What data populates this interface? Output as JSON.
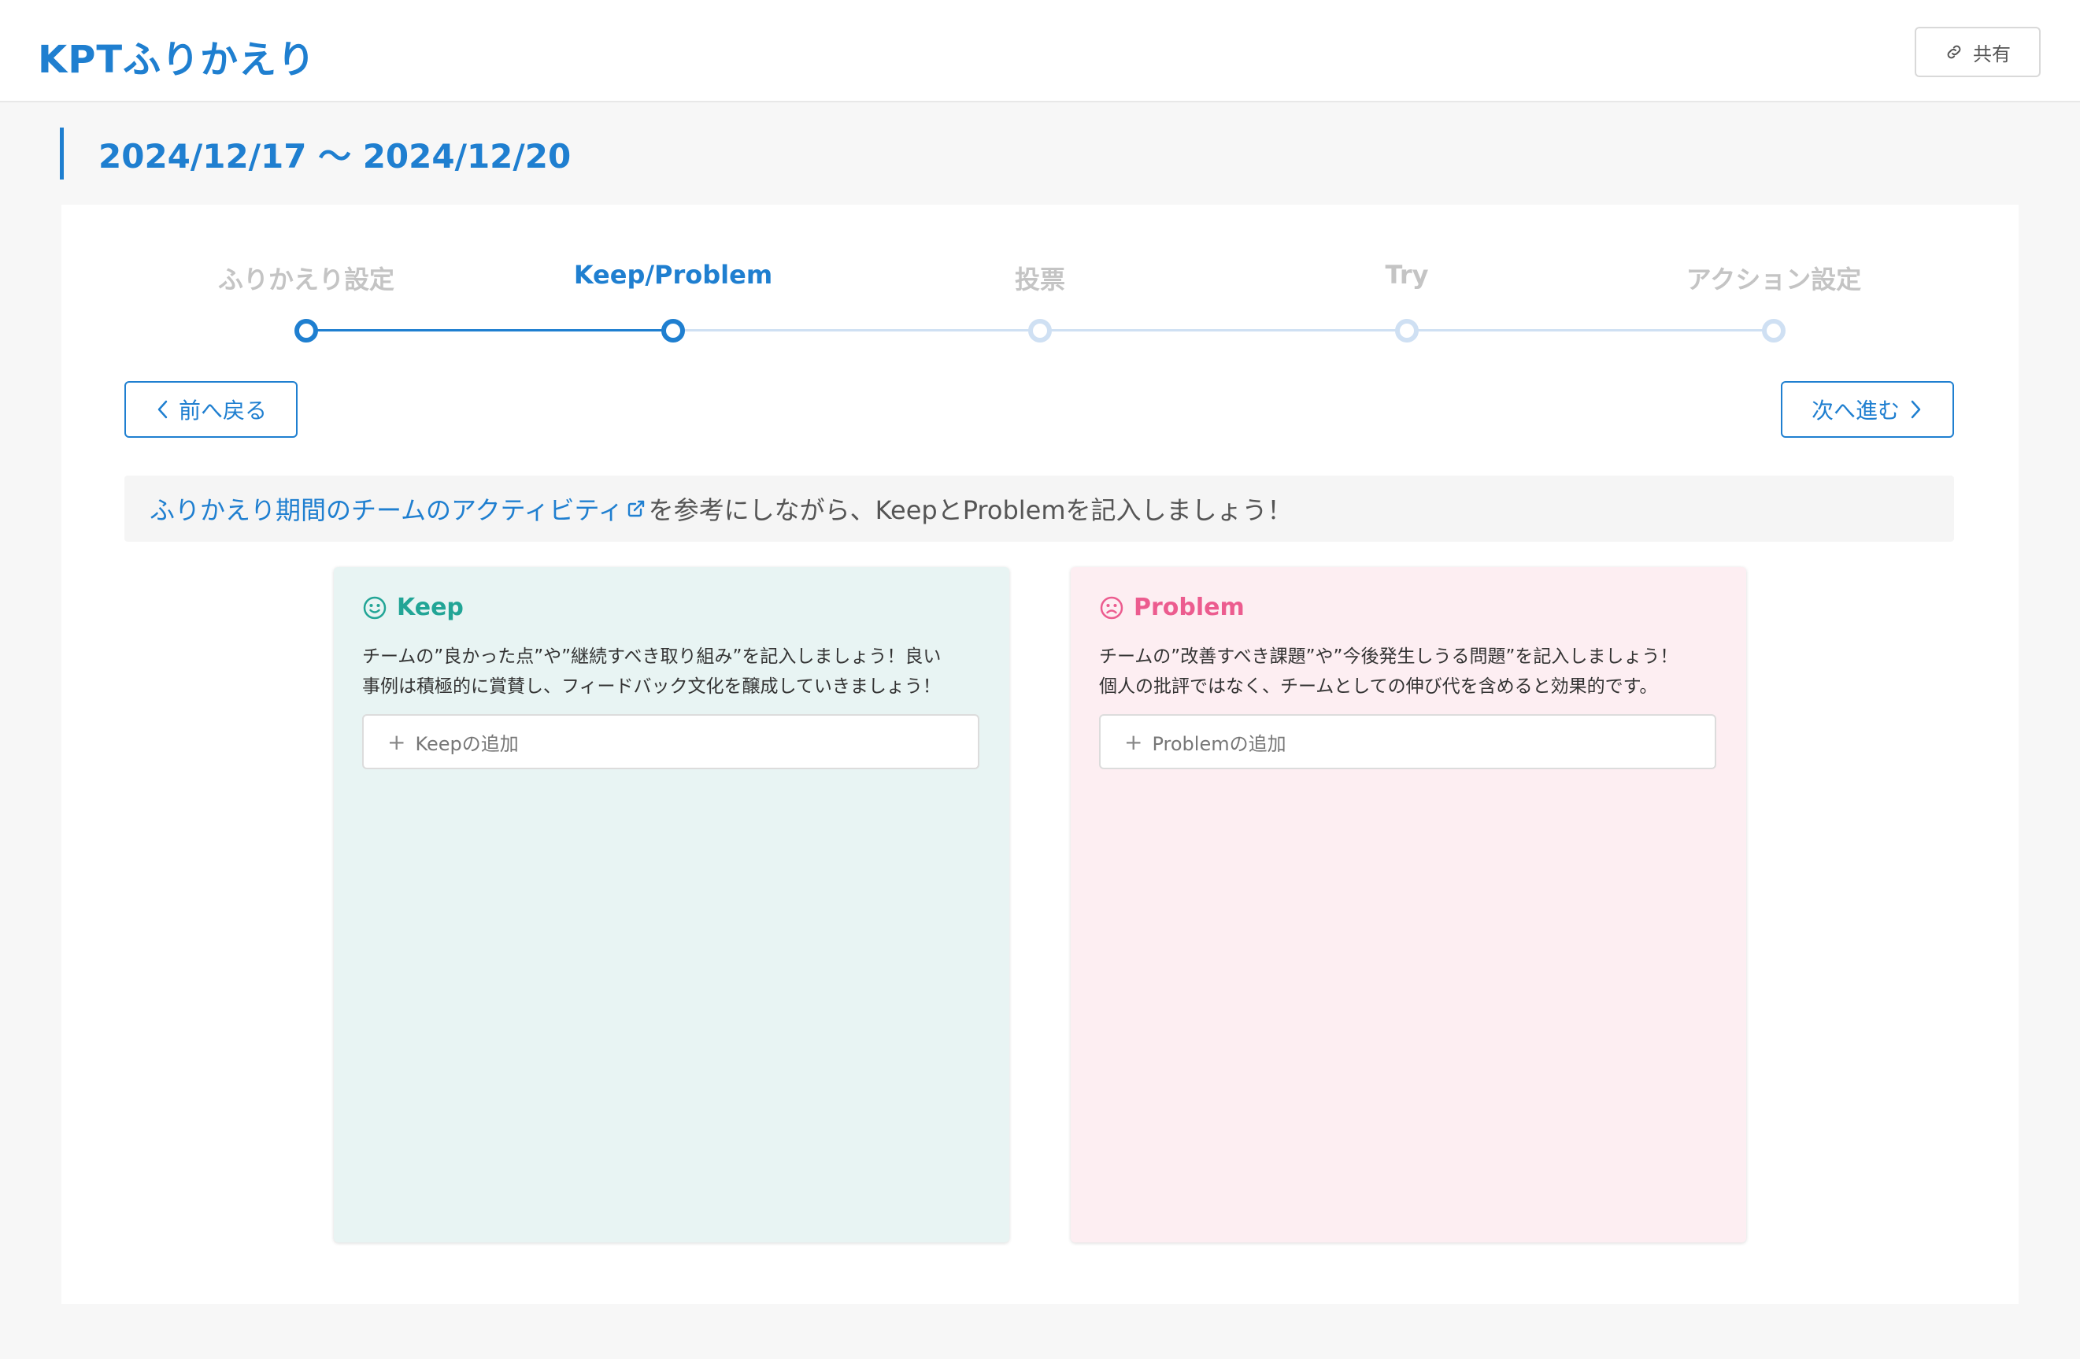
{
  "header": {
    "title": "KPTふりかえり",
    "share_label": "共有",
    "share_icon": "link-icon"
  },
  "period": "2024/12/17 〜 2024/12/20",
  "steps": [
    {
      "label": "ふりかえり設定",
      "state": "done"
    },
    {
      "label": "Keep/Problem",
      "state": "current"
    },
    {
      "label": "投票",
      "state": "todo"
    },
    {
      "label": "Try",
      "state": "todo"
    },
    {
      "label": "アクション設定",
      "state": "todo"
    }
  ],
  "nav": {
    "prev_label": "前へ戻る",
    "next_label": "次へ進む"
  },
  "notice": {
    "link_text": "ふりかえり期間のチームのアクティビティ",
    "link_icon": "external-link-icon",
    "text": "を参考にしながら、KeepとProblemを記入しましょう！"
  },
  "keep": {
    "title": "Keep",
    "icon": "smile-icon",
    "description": "チームの”良かった点”や”継続すべき取り組み”を記入しましょう！良い\n事例は積極的に賞賛し、フィードバック文化を醸成していきましょう！",
    "add_label": "Keepの追加"
  },
  "problem": {
    "title": "Problem",
    "icon": "frown-icon",
    "description": "チームの”改善すべき課題”や”今後発生しうる問題”を記入しましょう！\n個人の批評ではなく、チームとしての伸び代を含めると効果的です。",
    "add_label": "Problemの追加"
  },
  "colors": {
    "accent": "#1f7fd0",
    "keep": "#22a596",
    "keep_bg": "#e8f4f3",
    "problem": "#ec5c8f",
    "problem_bg": "#fdeef2",
    "step_inactive": "#cfe0f3"
  }
}
